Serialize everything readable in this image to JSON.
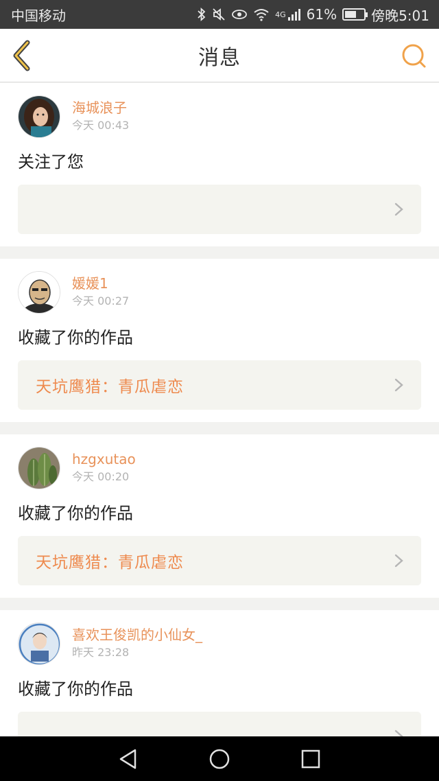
{
  "status_bar": {
    "carrier": "中国移动",
    "network": "4G",
    "battery_percent": "61%",
    "battery_level": 0.61,
    "time": "傍晚5:01",
    "icons": [
      "bluetooth-icon",
      "mute-icon",
      "eye-icon",
      "wifi-icon",
      "signal-icon",
      "battery-icon"
    ]
  },
  "header": {
    "title": "消息",
    "back_icon": "chevron-left-icon",
    "search_icon": "search-icon",
    "accent_color": "#f0a24a"
  },
  "messages": [
    {
      "user": "海城浪子",
      "time": "今天 00:43",
      "action": "关注了您",
      "work_title": "",
      "avatar": "avatar-woman-photo"
    },
    {
      "user": "媛媛1",
      "time": "今天 00:27",
      "action": "收藏了你的作品",
      "work_title": "天坑鹰猎：青瓜虐恋",
      "avatar": "avatar-cartoon-man"
    },
    {
      "user": "hzgxutao",
      "time": "今天 00:20",
      "action": "收藏了你的作品",
      "work_title": "天坑鹰猎：青瓜虐恋",
      "avatar": "avatar-cactus-photo"
    },
    {
      "user": "喜欢王俊凯的小仙女_",
      "time": "昨天 23:28",
      "action": "收藏了你的作品",
      "work_title": "",
      "avatar": "avatar-portrait-photo"
    }
  ],
  "system_nav": {
    "back": "triangle-back-icon",
    "home": "circle-home-icon",
    "recents": "square-recents-icon"
  },
  "colors": {
    "username": "#e8925a",
    "work_title": "#ee8a4e",
    "timestamp": "#b3b3b3",
    "card_link_bg": "#f4f4ef"
  }
}
